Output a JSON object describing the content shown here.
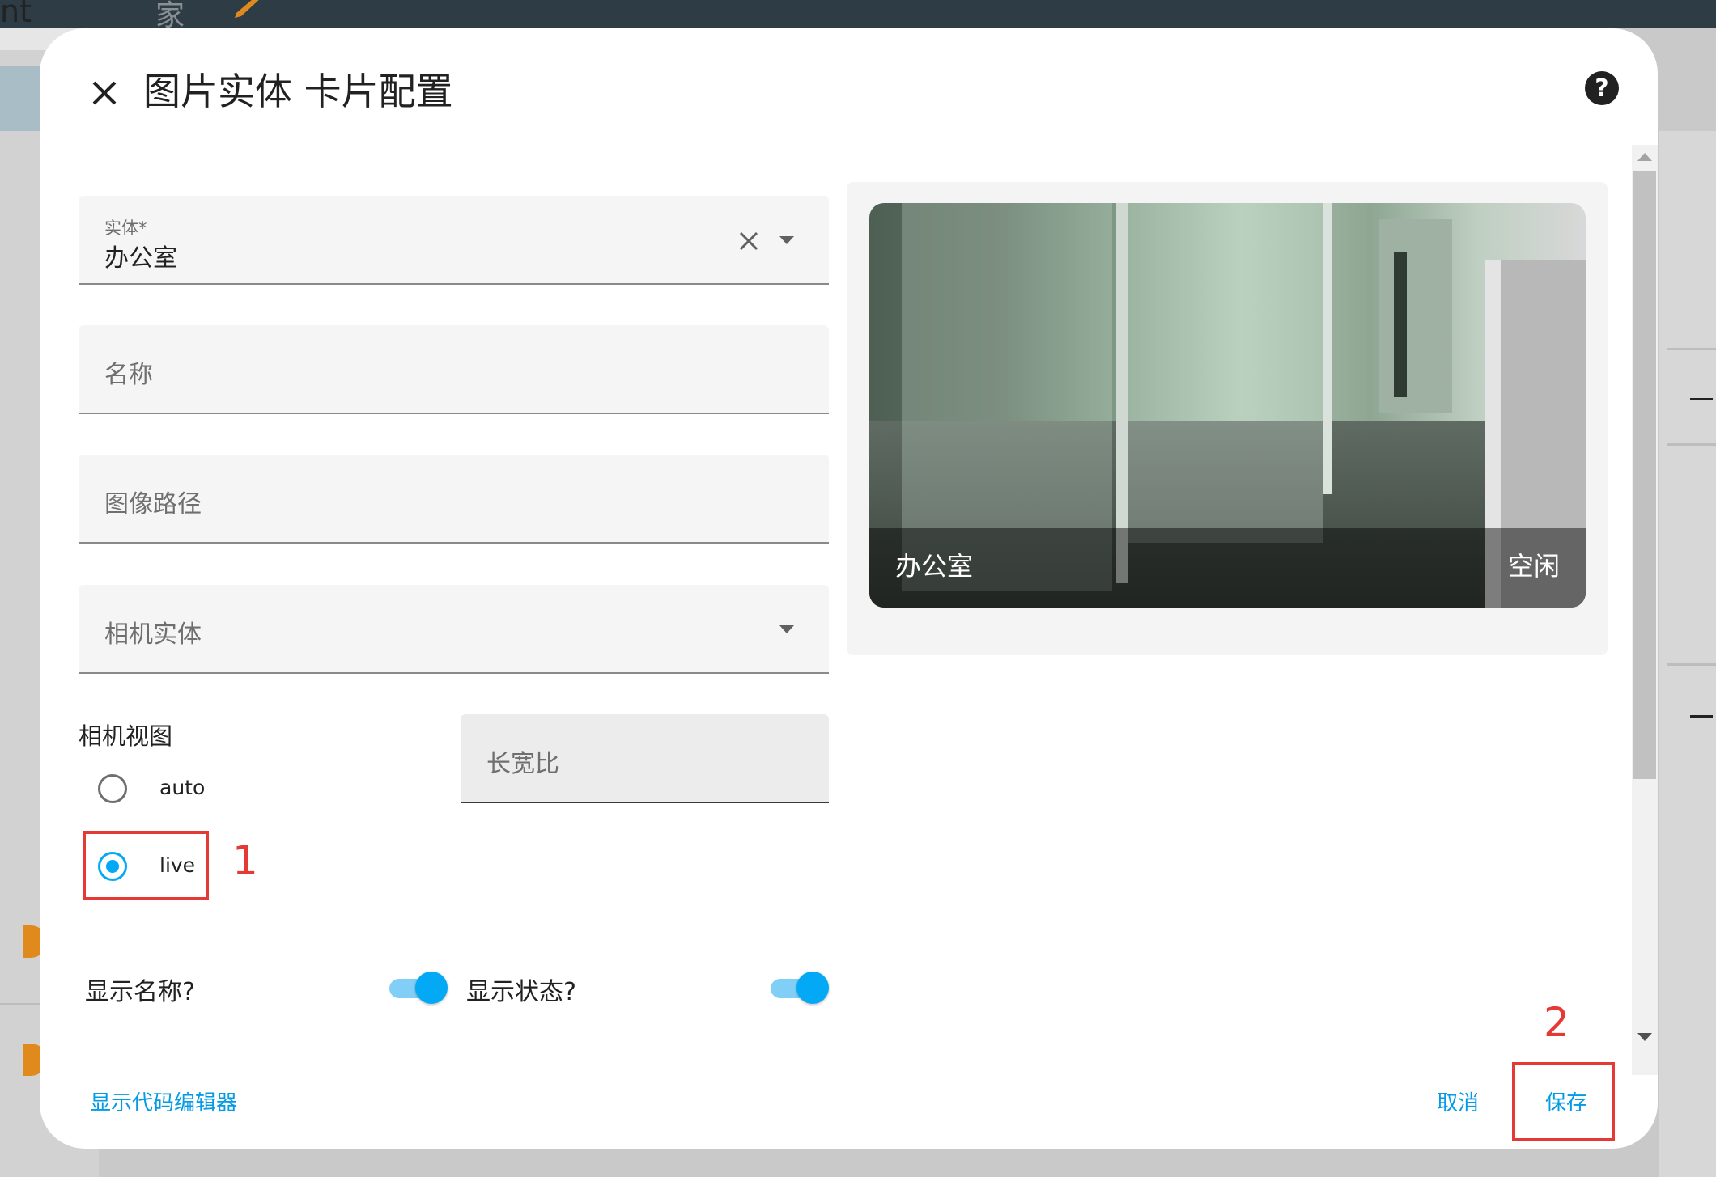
{
  "background": {
    "partial_title": "nt",
    "home_char": "家"
  },
  "dialog": {
    "title": "图片实体 卡片配置",
    "entity_field": {
      "label": "实体*",
      "value": "办公室"
    },
    "name_field": {
      "placeholder": "名称"
    },
    "image_path_field": {
      "placeholder": "图像路径"
    },
    "camera_entity_field": {
      "placeholder": "相机实体"
    },
    "camera_view": {
      "label": "相机视图",
      "options": [
        "auto",
        "live"
      ],
      "selected": "live"
    },
    "aspect_ratio_field": {
      "placeholder": "长宽比"
    },
    "toggles": {
      "show_name": {
        "label": "显示名称?",
        "on": true
      },
      "show_state": {
        "label": "显示状态?",
        "on": true
      }
    },
    "preview": {
      "entity_name": "办公室",
      "entity_state": "空闲"
    },
    "footer": {
      "code_editor": "显示代码编辑器",
      "cancel": "取消",
      "save": "保存"
    }
  },
  "annotations": {
    "step1": "1",
    "step2": "2",
    "color": "#e53935"
  },
  "colors": {
    "accent": "#03a9f4",
    "link": "#039be5"
  }
}
